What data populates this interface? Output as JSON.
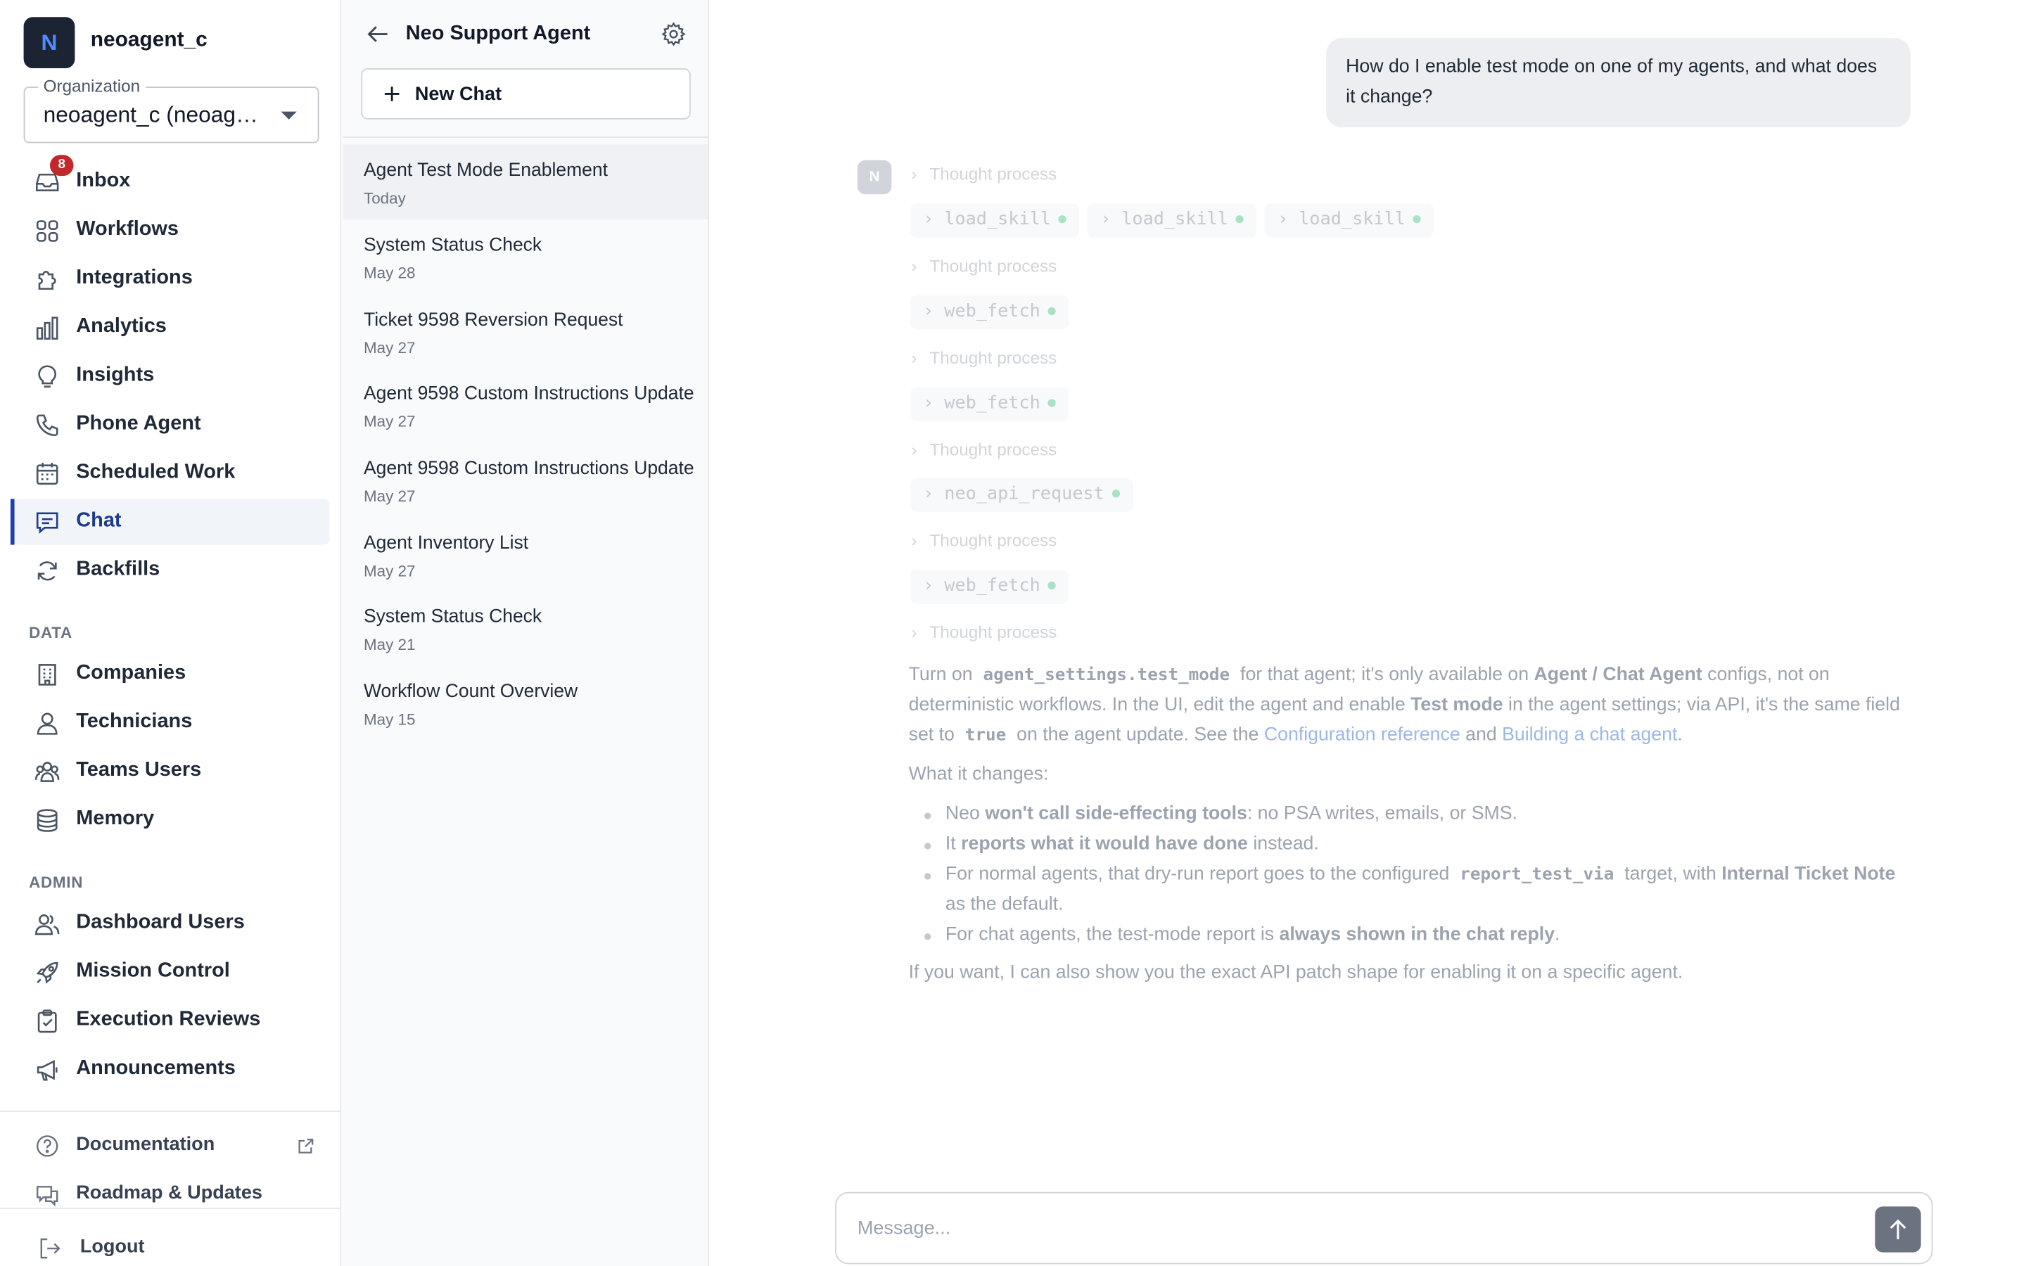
{
  "sidebar": {
    "logo_letter": "N",
    "brand": "neoagent_c",
    "org_label": "Organization",
    "org_value": "neoagent_c (neoagent_c)",
    "nav": [
      {
        "label": "Inbox",
        "icon": "inbox-icon",
        "badge": "8"
      },
      {
        "label": "Workflows",
        "icon": "grid-icon"
      },
      {
        "label": "Integrations",
        "icon": "puzzle-icon"
      },
      {
        "label": "Analytics",
        "icon": "bar-chart-icon"
      },
      {
        "label": "Insights",
        "icon": "lightbulb-icon"
      },
      {
        "label": "Phone Agent",
        "icon": "phone-icon"
      },
      {
        "label": "Scheduled Work",
        "icon": "calendar-icon"
      },
      {
        "label": "Chat",
        "icon": "chat-icon",
        "active": true
      },
      {
        "label": "Backfills",
        "icon": "refresh-icon"
      }
    ],
    "data_title": "DATA",
    "data_nav": [
      {
        "label": "Companies",
        "icon": "building-icon"
      },
      {
        "label": "Technicians",
        "icon": "user-icon"
      },
      {
        "label": "Teams Users",
        "icon": "users-icon"
      },
      {
        "label": "Memory",
        "icon": "database-icon"
      }
    ],
    "admin_title": "ADMIN",
    "admin_nav": [
      {
        "label": "Dashboard Users",
        "icon": "users-icon"
      },
      {
        "label": "Mission Control",
        "icon": "rocket-icon"
      },
      {
        "label": "Execution Reviews",
        "icon": "clipboard-icon"
      },
      {
        "label": "Announcements",
        "icon": "megaphone-icon"
      }
    ],
    "footer": {
      "documentation": "Documentation",
      "roadmap": "Roadmap & Updates",
      "logout": "Logout"
    }
  },
  "conversations": {
    "title": "Neo Support Agent",
    "new_chat": "New Chat",
    "items": [
      {
        "title": "Agent Test Mode Enablement",
        "date": "Today",
        "active": true
      },
      {
        "title": "System Status Check",
        "date": "May 28"
      },
      {
        "title": "Ticket 9598 Reversion Request",
        "date": "May 27"
      },
      {
        "title": "Agent 9598 Custom Instructions Update",
        "date": "May 27"
      },
      {
        "title": "Agent 9598 Custom Instructions Update",
        "date": "May 27"
      },
      {
        "title": "Agent Inventory List",
        "date": "May 27"
      },
      {
        "title": "System Status Check",
        "date": "May 21"
      },
      {
        "title": "Workflow Count Overview",
        "date": "May 15"
      }
    ]
  },
  "chat": {
    "user_message": "How do I enable test mode on one of my agents, and what does it change?",
    "avatar": "N",
    "thought_label": "Thought process",
    "tools": {
      "load_skill": "load_skill",
      "web_fetch": "web_fetch",
      "neo_api_request": "neo_api_request"
    },
    "answer": {
      "p1_a": "Turn on",
      "p1_code1": "agent_settings.test_mode",
      "p1_b": "for that agent; it's only available on",
      "p1_bold1": "Agent / Chat Agent",
      "p1_c": "configs, not on deterministic workflows. In the UI, edit the agent and enable",
      "p1_bold2": "Test mode",
      "p1_d": "in the agent settings; via API, it's the same field set to",
      "p1_code2": "true",
      "p1_e": "on the agent update. See the",
      "p1_link1": "Configuration reference",
      "p1_f": "and",
      "p1_link2": "Building a chat agent",
      "p1_g": ".",
      "p2": "What it changes:",
      "b1_a": "Neo",
      "b1_bold": "won't call side-effecting tools",
      "b1_b": ": no PSA writes, emails, or SMS.",
      "b2_a": "It",
      "b2_bold": "reports what it would have done",
      "b2_b": "instead.",
      "b3_a": "For normal agents, that dry-run report goes to the configured",
      "b3_code": "report_test_via",
      "b3_b": "target, with",
      "b3_bold": "Internal Ticket Note",
      "b3_c": "as the default.",
      "b4_a": "For chat agents, the test-mode report is",
      "b4_bold": "always shown in the chat reply",
      "b4_b": ".",
      "p3": "If you want, I can also show you the exact API patch shape for enabling it on a specific agent."
    },
    "composer_placeholder": "Message..."
  }
}
